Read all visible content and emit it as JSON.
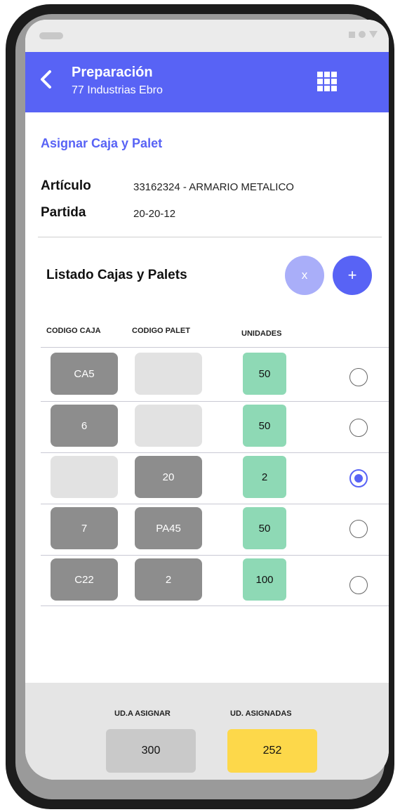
{
  "app": {
    "title": "Preparación",
    "subtitle": "77   Industrias Ebro"
  },
  "section_title": "Asignar Caja y Palet",
  "details": {
    "articulo_label": "Artículo",
    "articulo_value": "33162324 - ARMARIO METALICO",
    "partida_label": "Partida",
    "partida_value": "20-20-12"
  },
  "list": {
    "title": "Listado Cajas y Palets",
    "clear_label": "x",
    "add_label": "+",
    "headers": {
      "caja": "CODIGO CAJA",
      "palet": "CODIGO PALET",
      "unidades": "UNIDADES"
    },
    "rows": [
      {
        "caja": "CA5",
        "palet": "",
        "unidades": "50",
        "selected": false
      },
      {
        "caja": "6",
        "palet": "",
        "unidades": "50",
        "selected": false
      },
      {
        "caja": "",
        "palet": "20",
        "unidades": "2",
        "selected": true
      },
      {
        "caja": "7",
        "palet": "PA45",
        "unidades": "50",
        "selected": false
      },
      {
        "caja": "C22",
        "palet": "2",
        "unidades": "100",
        "selected": false
      }
    ]
  },
  "footer": {
    "asignar_label": "UD.A ASIGNAR",
    "asignar_value": "300",
    "asignadas_label": "UD. ASIGNADAS",
    "asignadas_value": "252"
  },
  "colors": {
    "accent": "#5863f5",
    "accent_light": "#a9aef9",
    "units_bg": "#8ed9b5",
    "assigned_bg": "#fdd84a",
    "to_assign_bg": "#c9c9c9"
  },
  "icons": {
    "back": "chevron-left-icon",
    "menu": "grid-menu-icon",
    "selected": "radio-selected-icon",
    "unselected": "radio-unselected-icon"
  }
}
